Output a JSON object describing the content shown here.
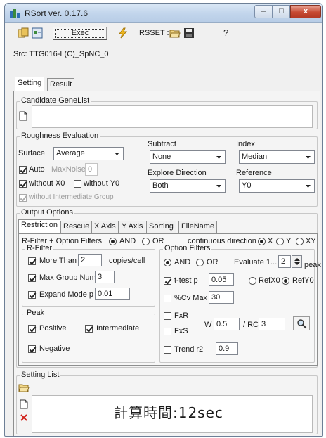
{
  "window": {
    "title": "RSort ver. 0.17.6",
    "min_label": "–",
    "max_label": "□",
    "close_label": "x"
  },
  "toolbar": {
    "exec_label": "Exec",
    "rsset_label": "RSSET :",
    "help_label": "?"
  },
  "src": {
    "text": "Src: TTG016-L(C)_SpNC_0"
  },
  "tabs": {
    "setting": "Setting",
    "result": "Result"
  },
  "candidate": {
    "title": "Candidate GeneList"
  },
  "roughness": {
    "title": "Roughness Evaluation",
    "surface_label": "Surface",
    "surface_value": "Average",
    "auto_label": "Auto",
    "maxnoise_label": "MaxNoise",
    "maxnoise_value": "0",
    "without_x0": "without X0",
    "without_y0": "without Y0",
    "without_intermediate": "without Intermediate Group",
    "subtract_label": "Subtract",
    "subtract_value": "None",
    "index_label": "Index",
    "index_value": "Median",
    "explore_label": "Explore Direction",
    "explore_value": "Both",
    "reference_label": "Reference",
    "reference_value": "Y0"
  },
  "output": {
    "title": "Output Options",
    "tabs": [
      "Restriction",
      "Rescue",
      "X Axis",
      "Y Axis",
      "Sorting",
      "FileName"
    ],
    "rfilter_combo_label": "R-Filter + Option Filters",
    "and_label": "AND",
    "or_label": "OR",
    "continuous_label": "continuous direction",
    "x_label": "X",
    "y_label": "Y",
    "xy_label": "XY",
    "rfilter": {
      "title": "R-Filter",
      "more_than_label": "More Than",
      "more_than_value": "2",
      "copies_label": "copies/cell",
      "max_group_label": "Max Group Num",
      "max_group_value": "3",
      "expand_label": "Expand Mode  p",
      "expand_value": "0.01"
    },
    "peak": {
      "title": "Peak",
      "positive": "Positive",
      "intermediate": "Intermediate",
      "negative": "Negative"
    },
    "option_filters": {
      "title": "Option Filters",
      "and_label": "AND",
      "or_label": "OR",
      "evaluate_label": "Evaluate 1...",
      "evaluate_value": "2",
      "peak_label": "peak",
      "ttest_label": "t-test  p",
      "ttest_value": "0.05",
      "refx0_label": "RefX0",
      "refy0_label": "RefY0",
      "cv_label": "%Cv  Max",
      "cv_value": "30",
      "fxr_label": "FxR",
      "fxs_label": "FxS",
      "w_label": "W",
      "w_value": "0.5",
      "rc_label": "/ RC",
      "rc_value": "3",
      "trend_label": "Trend  r2",
      "trend_value": "0.9"
    }
  },
  "setting_list": {
    "title": "Setting List"
  },
  "overlay": {
    "text": "計算時間:12sec"
  }
}
